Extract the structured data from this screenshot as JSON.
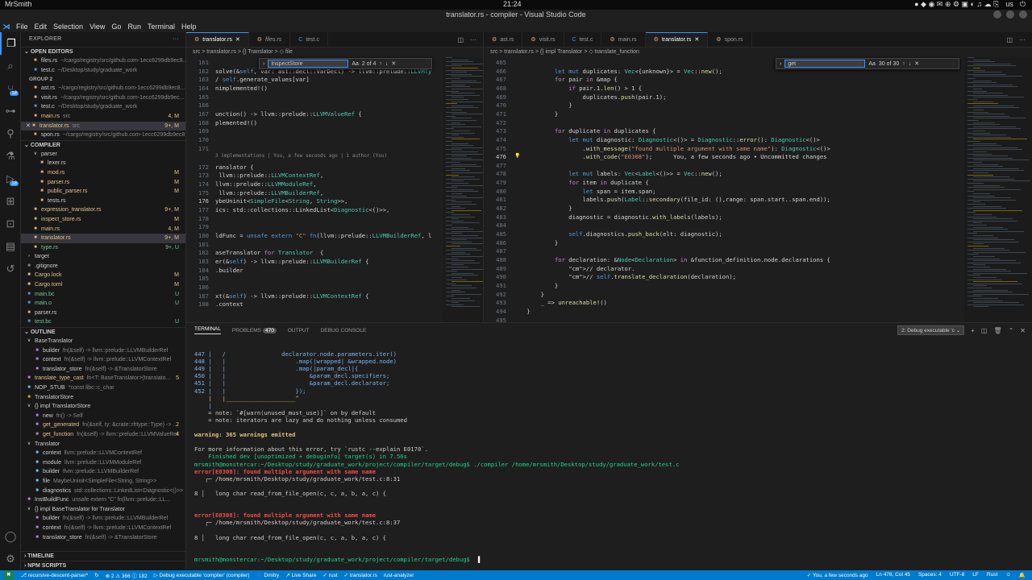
{
  "system": {
    "user": "MrSmith",
    "clock": "21:24",
    "locale": "us"
  },
  "window": {
    "title": "translator.rs - compiler - Visual Studio Code"
  },
  "menu": [
    "File",
    "Edit",
    "Selection",
    "View",
    "Go",
    "Run",
    "Terminal",
    "Help"
  ],
  "activity": [
    {
      "icon": "files-icon",
      "active": true
    },
    {
      "icon": "search-icon"
    },
    {
      "icon": "source-control-icon",
      "badge": "18"
    },
    {
      "icon": "git-graph-icon"
    },
    {
      "icon": "search-alt-icon"
    },
    {
      "icon": "flask-icon"
    },
    {
      "icon": "run-debug-icon",
      "badge": "18"
    },
    {
      "icon": "extensions-icon"
    },
    {
      "icon": "remote-explorer-icon"
    },
    {
      "icon": "docker-icon"
    },
    {
      "icon": "live-share-icon"
    }
  ],
  "sidebar": {
    "title": "EXPLORER",
    "open_editors_label": "OPEN EDITORS",
    "group2_label": "GROUP 2",
    "open_editors": [
      {
        "name": "files.rs",
        "desc": "~/cargo/registry/src/github.com-1ecc6299db9ec8...",
        "color": "#dea584"
      },
      {
        "name": "test.c",
        "desc": "~/Desktop/study/graduate_work",
        "color": "#5b8fd0"
      }
    ],
    "group2": [
      {
        "name": "ast.rs",
        "desc": "~/cargo/registry/src/github.com-1ecc6299db9ec8...",
        "color": "#dea584"
      },
      {
        "name": "visit.rs",
        "desc": "~/cargo/registry/src/github.com-1ecc6299db9ec...",
        "color": "#dea584"
      },
      {
        "name": "test.c",
        "desc": "~/Desktop/study/graduate_work",
        "color": "#5b8fd0"
      },
      {
        "name": "main.rs",
        "desc": "src",
        "status": "4, M",
        "color": "#dea584"
      },
      {
        "name": "translator.rs",
        "desc": "src",
        "status": "9+, M",
        "color": "#dea584",
        "selected": true,
        "close": "✕"
      },
      {
        "name": "spon.rs",
        "desc": "~/cargo/registry/src/github.com-1ecc6299db9ec8...",
        "color": "#dea584"
      }
    ],
    "project_label": "COMPILER",
    "files": [
      {
        "name": "parser",
        "indent": 1,
        "chev": "∨",
        "folder": true
      },
      {
        "name": "lexer.rs",
        "indent": 2,
        "color": "#dea584"
      },
      {
        "name": "mod.rs",
        "indent": 2,
        "status": "M",
        "color": "#dea584"
      },
      {
        "name": "parser.rs",
        "indent": 2,
        "status": "M",
        "color": "#dea584"
      },
      {
        "name": "public_parser.rs",
        "indent": 2,
        "status": "M",
        "color": "#dea584"
      },
      {
        "name": "tests.rs",
        "indent": 2,
        "color": "#dea584"
      },
      {
        "name": "expression_translator.rs",
        "indent": 1,
        "status": "9+, M",
        "color": "#dea584"
      },
      {
        "name": "inspect_store.rs",
        "indent": 1,
        "status": "M",
        "color": "#dea584"
      },
      {
        "name": "main.rs",
        "indent": 1,
        "status": "4, M",
        "color": "#dea584"
      },
      {
        "name": "translator.rs",
        "indent": 1,
        "status": "9+, M",
        "color": "#dea584",
        "selected": true
      },
      {
        "name": "type.rs",
        "indent": 1,
        "status": "9+, U",
        "color": "#dea584"
      },
      {
        "name": "target",
        "indent": 0,
        "chev": "›",
        "folder": true
      },
      {
        "name": ".gitignore",
        "indent": 0,
        "color": "#888"
      },
      {
        "name": "Cargo.lock",
        "indent": 0,
        "status": "M",
        "color": "#e2c08d"
      },
      {
        "name": "Cargo.toml",
        "indent": 0,
        "status": "M",
        "color": "#e2c08d"
      },
      {
        "name": "main.bc",
        "indent": 0,
        "status": "U",
        "color": "#5b8fd0"
      },
      {
        "name": "main.o",
        "indent": 0,
        "status": "U",
        "color": "#5b8fd0"
      },
      {
        "name": "parser.rs",
        "indent": 0,
        "color": "#dea584"
      },
      {
        "name": "test.bc",
        "indent": 0,
        "status": "U",
        "color": "#5b8fd0"
      }
    ],
    "outline_label": "OUTLINE",
    "outline": [
      {
        "name": "BaseTranslator",
        "desc": "",
        "indent": 0,
        "chev": "∨",
        "color": "#c586c0"
      },
      {
        "name": "builder",
        "desc": "fn(&self) -> llvm::prelude::LLVMBuilderRef",
        "indent": 1,
        "color": "#b180d7"
      },
      {
        "name": "context",
        "desc": "fn(&self) -> llvm::prelude::LLVMContextRef",
        "indent": 1,
        "color": "#b180d7"
      },
      {
        "name": "translator_store",
        "desc": "fn(&self) -> &TranslatorStore",
        "indent": 1,
        "color": "#b180d7"
      },
      {
        "name": "translate_type_cast",
        "desc": "fn<T: BaseTranslator>(translato...",
        "indent": 0,
        "status": "5",
        "color": "#b180d7"
      },
      {
        "name": "NOP_STUB",
        "desc": "*const libc::c_char",
        "indent": 0,
        "color": "#4fc1ff"
      },
      {
        "name": "TranslatorStore",
        "desc": "",
        "indent": 0,
        "color": "#ee9d28"
      },
      {
        "name": "{} impl TranslatorStore",
        "desc": "",
        "indent": 0,
        "chev": "∨",
        "color": "#ccc"
      },
      {
        "name": "new",
        "desc": "fn() -> Self",
        "indent": 1,
        "color": "#b180d7"
      },
      {
        "name": "get_generated",
        "desc": "fn(&self, ty: &crate::rhtype::Type) -> ...",
        "indent": 1,
        "status": "2",
        "color": "#b180d7"
      },
      {
        "name": "get_function",
        "desc": "fn(&self) -> llvm::prelude::LLVMValueRef",
        "indent": 1,
        "status": "4",
        "color": "#b180d7"
      },
      {
        "name": "Translator",
        "desc": "",
        "indent": 0,
        "chev": "∨",
        "color": "#ee9d28"
      },
      {
        "name": "context",
        "desc": "llvm::prelude::LLVMContextRef",
        "indent": 1,
        "color": "#75beff"
      },
      {
        "name": "module",
        "desc": "llvm::prelude::LLVMModuleRef",
        "indent": 1,
        "color": "#75beff"
      },
      {
        "name": "builder",
        "desc": "llvm::prelude::LLVMBuilderRef",
        "indent": 1,
        "color": "#75beff"
      },
      {
        "name": "file",
        "desc": "MaybeUninit<SimpleFile<String, String>>",
        "indent": 1,
        "color": "#75beff"
      },
      {
        "name": "diagnostics",
        "desc": "std::collections::LinkedList<Diagnostic<()>>",
        "indent": 1,
        "color": "#75beff"
      },
      {
        "name": "InstBuildFunc",
        "desc": "unsafe extern \"C\" fn(llvm::prelude::LL...",
        "indent": 0,
        "color": "#c586c0"
      },
      {
        "name": "{} impl BaseTranslator for Translator",
        "desc": "",
        "indent": 0,
        "chev": "∨",
        "color": "#ccc"
      },
      {
        "name": "builder",
        "desc": "fn(&self) -> llvm::prelude::LLVMBuilderRef",
        "indent": 1,
        "color": "#b180d7"
      },
      {
        "name": "context",
        "desc": "fn(&self) -> llvm::prelude::LLVMContextRef",
        "indent": 1,
        "color": "#b180d7"
      },
      {
        "name": "translator_store",
        "desc": "fn(&self) -> &TranslatorStore",
        "indent": 1,
        "color": "#b180d7"
      }
    ],
    "timeline_label": "TIMELINE",
    "npm_label": "NPM SCRIPTS"
  },
  "editor_left": {
    "tabs": [
      {
        "name": "translator.rs",
        "active": true,
        "kind": "rs"
      },
      {
        "name": "files.rs",
        "kind": "rs",
        "italic": true
      },
      {
        "name": "test.c",
        "kind": "c"
      }
    ],
    "breadcrumb": "src  >  translator.rs  >  {} Translator  >  ◇ file",
    "find": {
      "query": "InspectStore",
      "count": "2 of 4"
    },
    "hint": "3 implementations | You, a few seconds ago | 1 author (You)",
    "lines": [
      {
        "n": "161",
        "t": ""
      },
      {
        "n": "162",
        "t": "solve(&self, var: ast::decl::VarDecl) -> llvm::prelude::LLVMTy"
      },
      {
        "n": "163",
        "t": "/ self.generate_values[var]"
      },
      {
        "n": "164",
        "t": "nimplemented!()"
      },
      {
        "n": "165",
        "t": ""
      },
      {
        "n": "166",
        "t": ""
      },
      {
        "n": "167",
        "t": "unction() -> llvm::prelude::LLVMValueRef {"
      },
      {
        "n": "168",
        "t": "plemented!()"
      },
      {
        "n": "169",
        "t": ""
      },
      {
        "n": "170",
        "t": ""
      },
      {
        "n": "171",
        "t": ""
      },
      {
        "n": "172",
        "t": "ranslator {"
      },
      {
        "n": "173",
        "t": " llvm::prelude::LLVMContextRef,"
      },
      {
        "n": "174",
        "t": "llvm::prelude::LLVMModuleRef,"
      },
      {
        "n": "175",
        "t": " llvm::prelude::LLVMBuilderRef,"
      },
      {
        "n": "176",
        "t": "ybeUninit<SimpleFile<String, String>>,"
      },
      {
        "n": "177",
        "t": "ics: std::collections::LinkedList<Diagnostic<()>>,"
      },
      {
        "n": "178",
        "t": ""
      },
      {
        "n": "179",
        "t": ""
      },
      {
        "n": "180",
        "t": "ldFunc = unsafe extern \"C\" fn(llvm::prelude::LLVMBuilderRef, l"
      },
      {
        "n": "181",
        "t": ""
      },
      {
        "n": "182",
        "t": "aseTranslator for Translator  {"
      },
      {
        "n": "183",
        "t": "er(&self) -> llvm::prelude::LLVMBuilderRef {"
      },
      {
        "n": "184",
        "t": ".builder"
      },
      {
        "n": "185",
        "t": ""
      },
      {
        "n": "186",
        "t": ""
      },
      {
        "n": "187",
        "t": "xt(&self) -> llvm::prelude::LLVMContextRef {"
      },
      {
        "n": "188",
        "t": ".context"
      }
    ]
  },
  "editor_right": {
    "tabs": [
      {
        "name": "ast.rs",
        "kind": "rs"
      },
      {
        "name": "visit.rs",
        "kind": "rs"
      },
      {
        "name": "test.c",
        "kind": "c"
      },
      {
        "name": "main.rs",
        "kind": "rs"
      },
      {
        "name": "translator.rs",
        "active": true,
        "kind": "rs"
      },
      {
        "name": "spon.rs",
        "kind": "rs"
      }
    ],
    "breadcrumb": "src  >  translator.rs  >  {} impl Translator  >  ◇ translate_function",
    "find": {
      "query": "get",
      "count": "30 of 30"
    },
    "lines": [
      {
        "n": "465",
        "t": ""
      },
      {
        "n": "466",
        "t": "            let mut duplicates: Vec<{unknown}> = Vec::new();"
      },
      {
        "n": "467",
        "t": "            for pair in &map {"
      },
      {
        "n": "468",
        "t": "                if pair.1.len() > 1 {"
      },
      {
        "n": "469",
        "t": "                    duplicates.push(pair.1);"
      },
      {
        "n": "470",
        "t": "                }"
      },
      {
        "n": "471",
        "t": "            }"
      },
      {
        "n": "472",
        "t": ""
      },
      {
        "n": "473",
        "t": "            for duplicate in duplicates {"
      },
      {
        "n": "474",
        "t": "                let mut diagnostic: Diagnostic<()> = Diagnostic::error(): Diagnostic<()>"
      },
      {
        "n": "475",
        "t": "                    .with_message(\"found multiple argument with same name\"): Diagnostic<()>"
      },
      {
        "n": "476",
        "t": "                    .with_code(\"E0308\");      You, a few seconds ago • Uncommitted changes"
      },
      {
        "n": "477",
        "t": ""
      },
      {
        "n": "478",
        "t": "                let mut labels: Vec<Label<()>> = Vec::new();"
      },
      {
        "n": "479",
        "t": "                for item in duplicate {"
      },
      {
        "n": "480",
        "t": "                    let span = item.span;"
      },
      {
        "n": "481",
        "t": "                    labels.push(Label::secondary(file_id: (),range: span.start..span.end));"
      },
      {
        "n": "482",
        "t": "                }"
      },
      {
        "n": "483",
        "t": "                diagnostic = diagnostic.with_labels(labels);"
      },
      {
        "n": "484",
        "t": ""
      },
      {
        "n": "485",
        "t": "                self.diagnostics.push_back(elt: diagnostic);"
      },
      {
        "n": "486",
        "t": "            }"
      },
      {
        "n": "487",
        "t": ""
      },
      {
        "n": "488",
        "t": "            for declaration: &Node<Declaration> in &function_definition.node.declarations {"
      },
      {
        "n": "489",
        "t": "                // declarator."
      },
      {
        "n": "490",
        "t": "                // self.translate_declaration(declaration);"
      },
      {
        "n": "491",
        "t": "            }"
      },
      {
        "n": "492",
        "t": "        }"
      },
      {
        "n": "493",
        "t": "        _ => unreachable!()"
      },
      {
        "n": "494",
        "t": "    }"
      },
      {
        "n": "495",
        "t": ""
      }
    ]
  },
  "panel": {
    "tabs": [
      {
        "name": "TERMINAL",
        "active": true
      },
      {
        "name": "PROBLEMS",
        "count": "470"
      },
      {
        "name": "OUTPUT"
      },
      {
        "name": "DEBUG CONSOLE"
      }
    ],
    "terminal_select": "2: Debug executable 'c",
    "lines": [
      {
        "t": "447 |   /                declarator.node.parameters.iter()",
        "c": "blue"
      },
      {
        "t": "448 |   |                    .map(|wrapped| &wrapped.node)",
        "c": "blue"
      },
      {
        "t": "449 |   |                    .map(|param_decl|{",
        "c": "blue"
      },
      {
        "t": "450 |   |                        &param_decl.specifiers;",
        "c": "blue"
      },
      {
        "t": "451 |   |                        &param_decl.declarator;",
        "c": "blue"
      },
      {
        "t": "452 |   |                    });",
        "c": "blue"
      },
      {
        "t": "    |   |____________________^",
        "c": "yel"
      },
      {
        "t": "    |",
        "c": "blue"
      },
      {
        "t": "    = note: `#[warn(unused_must_use)]` on by default",
        "c": "plain"
      },
      {
        "t": "    = note: iterators are lazy and do nothing unless consumed",
        "c": "plain"
      },
      {
        "t": "",
        "c": "plain"
      },
      {
        "t": "warning: 365 warnings emitted",
        "c": "yelbold"
      },
      {
        "t": "",
        "c": "plain"
      },
      {
        "t": "For more information about this error, try `rustc --explain E0170`.",
        "c": "plain"
      },
      {
        "t": "    Finished dev [unoptimized + debuginfo] target(s) in 7.56s",
        "c": "grn"
      },
      {
        "t": "mrsmith@monstercar:~/Desktop/study/graduate_work/project/compiler/target/debug$ ./compiler /home/mrsmith/Desktop/study/graduate_work/test.c",
        "c": "prompt"
      },
      {
        "t": "error[E0308]: found multiple argument with same name",
        "c": "err"
      },
      {
        "t": "   ┌─ /home/mrsmith/Desktop/study/graduate_work/test.c:8:31",
        "c": "plain"
      },
      {
        "t": "",
        "c": "plain"
      },
      {
        "t": "8 │   long char read_from_file_open(c, c, a, b, a, c) {",
        "c": "plain"
      },
      {
        "t": "",
        "c": "plain"
      },
      {
        "t": "",
        "c": "plain"
      },
      {
        "t": "error[E0308]: found multiple argument with same name",
        "c": "err"
      },
      {
        "t": "   ┌─ /home/mrsmith/Desktop/study/graduate_work/test.c:8:37",
        "c": "plain"
      },
      {
        "t": "",
        "c": "plain"
      },
      {
        "t": "8 │   long char read_from_file_open(c, c, a, b, a, c) {",
        "c": "plain"
      },
      {
        "t": "",
        "c": "plain"
      },
      {
        "t": "",
        "c": "plain"
      },
      {
        "t": "mrsmith@monstercar:~/Desktop/study/graduate_work/project/compiler/target/debug$ ",
        "c": "prompt2"
      }
    ]
  },
  "status": {
    "remote": "✖",
    "branch": "recursive-descent-parser*",
    "sync": "↻",
    "problems": "⊗ 2 ⚠ 366 ⓘ 182",
    "debug": "▷ Debug executable 'compiler' (compiler)",
    "user": "Dmitry",
    "liveshare": "Live Share",
    "crate": "rust",
    "file": "translator.rs",
    "analyzer": "rust-analyzer",
    "blame": "You, a few seconds ago",
    "position": "Ln 476, Col 45",
    "spaces": "Spaces: 4",
    "encoding": "UTF-8",
    "eol": "LF",
    "language": "Rust"
  }
}
